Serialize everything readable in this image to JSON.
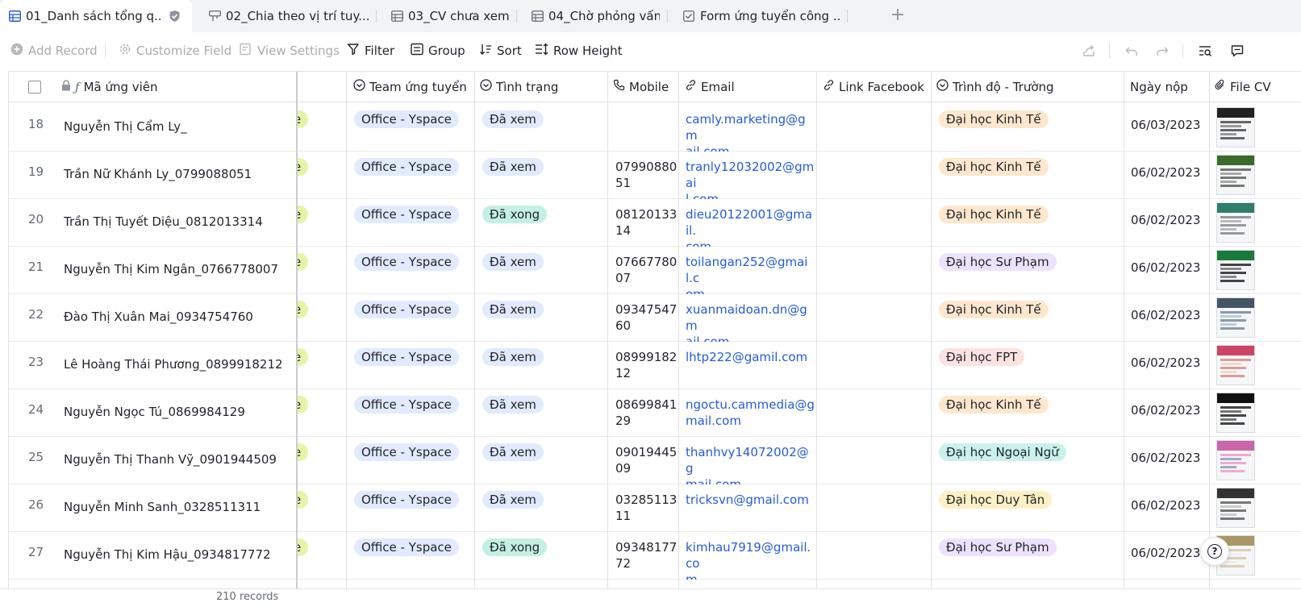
{
  "tabs": [
    {
      "label": "01_Danh sách tổng q...",
      "icon": "grid-table-icon",
      "active": true
    },
    {
      "label": "02_Chia theo vị trí tuy...",
      "icon": "kanban-icon",
      "active": false
    },
    {
      "label": "03_CV chưa xem",
      "icon": "grid-table-icon",
      "active": false
    },
    {
      "label": "04_Chờ phỏng vấn",
      "icon": "grid-table-icon",
      "active": false
    },
    {
      "label": "Form ứng tuyển công ...",
      "icon": "form-icon",
      "active": false
    }
  ],
  "toolbar": {
    "add_record": "Add Record",
    "customize_field": "Customize Field",
    "view_settings": "View Settings",
    "filter": "Filter",
    "group": "Group",
    "sort": "Sort",
    "row_height": "Row Height"
  },
  "columns": {
    "ma_ung_vien": "Mã ứng viên",
    "team": "Team ứng tuyển",
    "tinh_trang": "Tình trạng",
    "mobile": "Mobile",
    "email": "Email",
    "facebook": "Link Facebook",
    "trinh_do": "Trình độ - Trường",
    "ngay_nop": "Ngày nộp",
    "file_cv": "File CV"
  },
  "colors": {
    "accent": "#245bdb",
    "tag_team": "#e1eaff",
    "tag_seen": "#e1eaff",
    "tag_done": "#c3f0e3",
    "tag_kinhte": "#fee7cd",
    "tag_supham": "#ece2fe",
    "tag_fpt": "#fde2e2",
    "tag_ngoaingu": "#c8f2eb",
    "tag_duytan": "#fdf0c4",
    "partial_tag": "#e6f4a8"
  },
  "rows": [
    {
      "n": "18",
      "name": "Nguyễn Thị Cẩm Ly_",
      "team": "Office - Yspace",
      "status": "Đã xem",
      "status_kind": "seen",
      "mobile1": "",
      "mobile2": "",
      "email1": "camly.marketing@gm",
      "email2": "ail.com",
      "school": "Đại học Kinh Tế",
      "school_kind": "kinhte",
      "date": "06/03/2023"
    },
    {
      "n": "19",
      "name": "Trần Nữ Khánh Ly_0799088051",
      "team": "Office - Yspace",
      "status": "Đã xem",
      "status_kind": "seen",
      "mobile1": "07990880",
      "mobile2": "51",
      "email1": "tranly12032002@gmai",
      "email2": "l.com",
      "school": "Đại học Kinh Tế",
      "school_kind": "kinhte",
      "date": "06/02/2023"
    },
    {
      "n": "20",
      "name": "Trần Thị Tuyết Diệu_0812013314",
      "team": "Office - Yspace",
      "status": "Đã xong",
      "status_kind": "done",
      "mobile1": "08120133",
      "mobile2": "14",
      "email1": "dieu20122001@gmail.",
      "email2": "com",
      "school": "Đại học Kinh Tế",
      "school_kind": "kinhte",
      "date": "06/02/2023"
    },
    {
      "n": "21",
      "name": "Nguyễn Thị Kim Ngân_0766778007",
      "team": "Office - Yspace",
      "status": "Đã xem",
      "status_kind": "seen",
      "mobile1": "07667780",
      "mobile2": "07",
      "email1": "toilangan252@gmail.c",
      "email2": "om",
      "school": "Đại học Sư Phạm",
      "school_kind": "supham",
      "date": "06/02/2023"
    },
    {
      "n": "22",
      "name": "Đào Thị Xuân Mai_0934754760",
      "team": "Office - Yspace",
      "status": "Đã xem",
      "status_kind": "seen",
      "mobile1": "09347547",
      "mobile2": "60",
      "email1": "xuanmaidoan.dn@gm",
      "email2": "ail.com",
      "school": "Đại học Kinh Tế",
      "school_kind": "kinhte",
      "date": "06/02/2023"
    },
    {
      "n": "23",
      "name": "Lê Hoàng Thái Phương_0899918212",
      "team": "Office - Yspace",
      "status": "Đã xem",
      "status_kind": "seen",
      "mobile1": "08999182",
      "mobile2": "12",
      "email1": "lhtp222@gamil.com",
      "email2": "",
      "school": "Đại học FPT",
      "school_kind": "fpt",
      "date": "06/02/2023"
    },
    {
      "n": "24",
      "name": "Nguyễn Ngọc Tú_0869984129",
      "team": "Office - Yspace",
      "status": "Đã xem",
      "status_kind": "seen",
      "mobile1": "08699841",
      "mobile2": "29",
      "email1": "ngoctu.cammedia@g",
      "email2": "mail.com",
      "school": "Đại học Kinh Tế",
      "school_kind": "kinhte",
      "date": "06/02/2023"
    },
    {
      "n": "25",
      "name": "Nguyễn Thị Thanh Vỹ_0901944509",
      "team": "Office - Yspace",
      "status": "Đã xem",
      "status_kind": "seen",
      "mobile1": "09019445",
      "mobile2": "09",
      "email1": "thanhvy14072002@g",
      "email2": "mail.com",
      "school": "Đại học Ngoại Ngữ",
      "school_kind": "ngoaingu",
      "date": "06/02/2023"
    },
    {
      "n": "26",
      "name": "Nguyễn Minh Sanh_0328511311",
      "team": "Office - Yspace",
      "status": "Đã xem",
      "status_kind": "seen",
      "mobile1": "03285113",
      "mobile2": "11",
      "email1": "tricksvn@gmail.com",
      "email2": "",
      "school": "Đại học Duy Tân",
      "school_kind": "duytan",
      "date": "06/02/2023"
    },
    {
      "n": "27",
      "name": "Nguyễn Thị Kim Hậu_0934817772",
      "team": "Office - Yspace",
      "status": "Đã xong",
      "status_kind": "done",
      "mobile1": "09348177",
      "mobile2": "72",
      "email1": "kimhau7919@gmail.co",
      "email2": "m",
      "school": "Đại học Sư Phạm",
      "school_kind": "supham",
      "date": "06/02/2023"
    }
  ],
  "partial_tag_letter": "e",
  "footer": {
    "records": "210 records"
  },
  "help": "?"
}
